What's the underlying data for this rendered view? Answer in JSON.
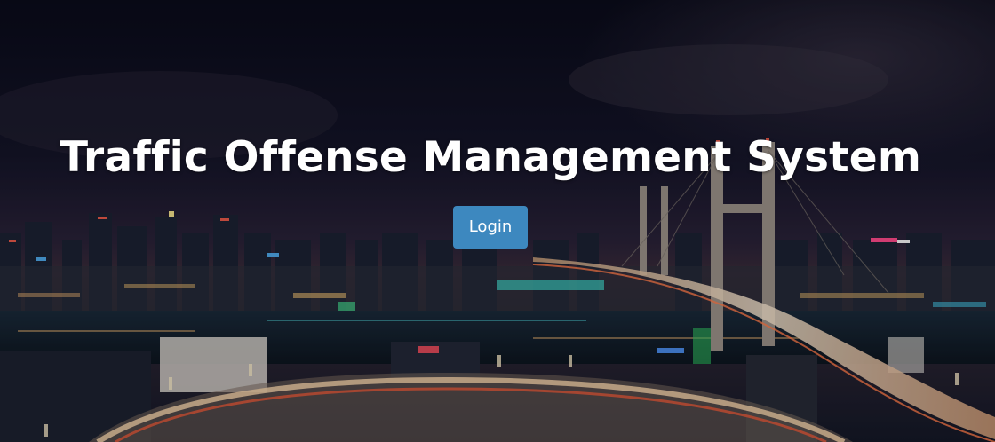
{
  "hero": {
    "title": "Traffic Offense Management System",
    "background_icon": "night-city-bridge-photo"
  },
  "actions": {
    "login_label": "Login"
  },
  "colors": {
    "button_bg": "#3d88bf",
    "title_text": "#ffffff",
    "night_sky": "#0b0d1c"
  }
}
